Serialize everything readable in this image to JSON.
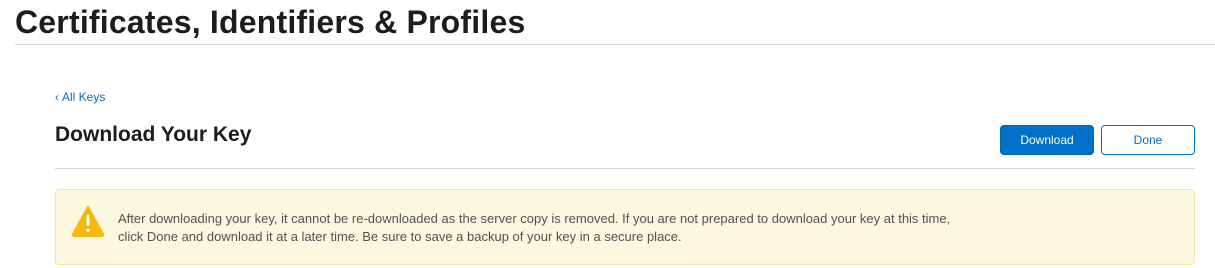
{
  "header": {
    "title": "Certificates, Identifiers & Profiles"
  },
  "nav": {
    "back_chevron": "‹",
    "back_label": "All Keys"
  },
  "page": {
    "title": "Download Your Key"
  },
  "actions": {
    "download_label": "Download",
    "done_label": "Done"
  },
  "alert": {
    "icon": "warning-icon",
    "message": "After downloading your key, it cannot be re-downloaded as the server copy is removed. If you are not prepared to download your key at this time, click Done and download it at a later time. Be sure to save a backup of your key in a secure place."
  },
  "colors": {
    "accent": "#0070c9",
    "warning_icon": "#f5b90f",
    "alert_background": "#fef7e0"
  }
}
